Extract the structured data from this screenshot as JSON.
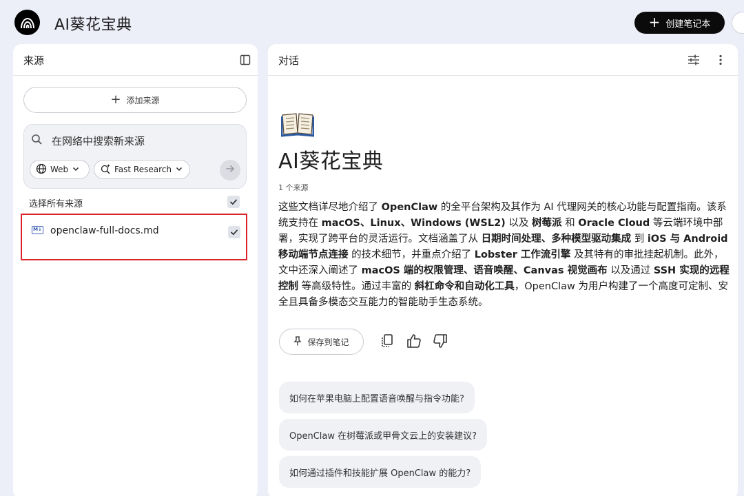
{
  "header": {
    "app_title": "AI葵花宝典",
    "create_button": "创建笔记本"
  },
  "sources": {
    "title": "来源",
    "add_source": "添加来源",
    "search_placeholder": "在网络中搜索新来源",
    "chip_web": "Web",
    "chip_research": "Fast Research",
    "select_all": "选择所有来源",
    "items": [
      {
        "name": "openclaw-full-docs.md",
        "icon": "markdown-file-icon",
        "checked": true
      }
    ]
  },
  "chat": {
    "title": "对话",
    "notebook_title": "AI葵花宝典",
    "source_count": "1 个来源",
    "summary": [
      {
        "t": "这些文档详尽地介绍了 "
      },
      {
        "t": "OpenClaw",
        "b": true
      },
      {
        "t": " 的全平台架构及其作为 AI 代理网关的核心功能与配置指南。该系统支持在 "
      },
      {
        "t": "macOS、Linux、Windows (WSL2)",
        "b": true
      },
      {
        "t": " 以及 "
      },
      {
        "t": "树莓派",
        "b": true
      },
      {
        "t": " 和 "
      },
      {
        "t": "Oracle Cloud",
        "b": true
      },
      {
        "t": " 等云端环境中部署，实现了跨平台的灵活运行。文档涵盖了从 "
      },
      {
        "t": "日期时间处理、多种模型驱动集成",
        "b": true
      },
      {
        "t": " 到 "
      },
      {
        "t": "iOS 与 Android 移动端节点连接",
        "b": true
      },
      {
        "t": " 的技术细节，并重点介绍了 "
      },
      {
        "t": "Lobster 工作流引擎",
        "b": true
      },
      {
        "t": " 及其特有的审批挂起机制。此外，文中还深入阐述了 "
      },
      {
        "t": "macOS 端的权限管理、语音唤醒、Canvas 视觉画布",
        "b": true
      },
      {
        "t": " 以及通过 "
      },
      {
        "t": "SSH 实现的远程控制",
        "b": true
      },
      {
        "t": " 等高级特性。通过丰富的 "
      },
      {
        "t": "斜杠命令和自动化工具",
        "b": true
      },
      {
        "t": "，OpenClaw 为用户构建了一个高度可定制、安全且具备多模态交互能力的智能助手生态系统。"
      }
    ],
    "save_note": "保存到笔记",
    "suggestions": [
      "如何在苹果电脑上配置语音唤醒与指令功能?",
      "OpenClaw 在树莓派或甲骨文云上的安装建议?",
      "如何通过插件和技能扩展 OpenClaw 的能力?"
    ]
  },
  "colors": {
    "background": "#eceef8",
    "panel": "#ffffff",
    "highlight_border": "#d9252a",
    "primary_button": "#0b0b0b"
  }
}
